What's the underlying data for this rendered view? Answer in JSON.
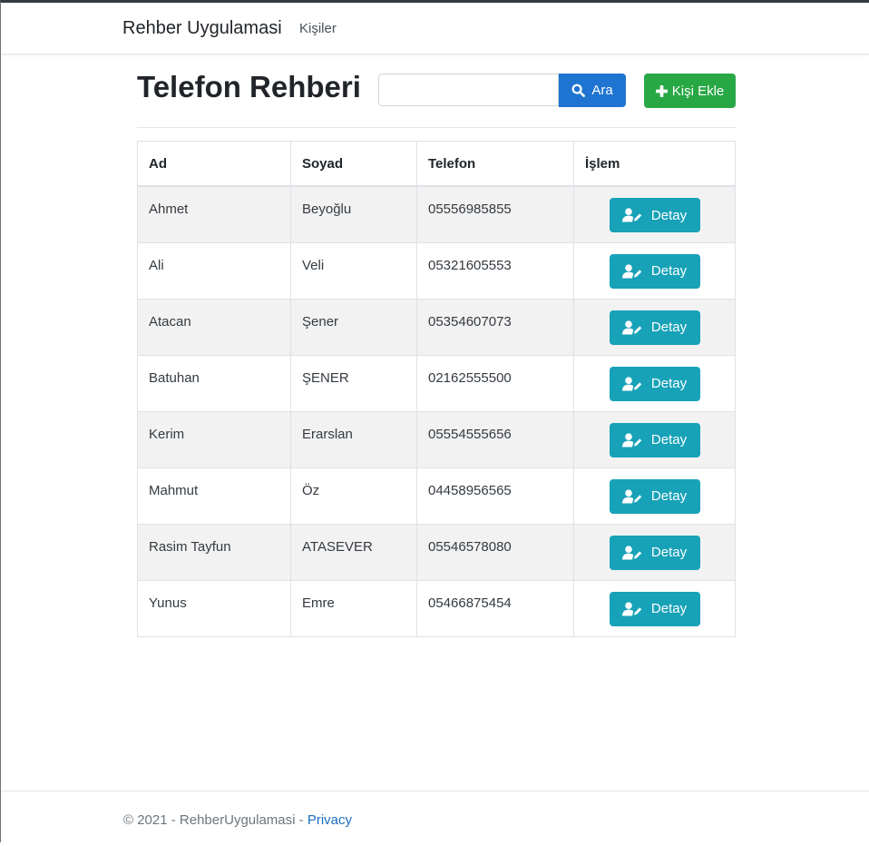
{
  "navbar": {
    "brand": "Rehber Uygulamasi",
    "links": [
      "Kişiler"
    ]
  },
  "header": {
    "title": "Telefon Rehberi",
    "search_placeholder": "",
    "search_value": "",
    "search_button": "Ara",
    "add_button": "Kişi Ekle"
  },
  "table": {
    "columns": [
      "Ad",
      "Soyad",
      "Telefon",
      "İşlem"
    ],
    "rows": [
      {
        "ad": "Ahmet",
        "soyad": "Beyoğlu",
        "telefon": "05556985855",
        "action": "Detay"
      },
      {
        "ad": "Ali",
        "soyad": "Veli",
        "telefon": "05321605553",
        "action": "Detay"
      },
      {
        "ad": "Atacan",
        "soyad": "Şener",
        "telefon": "05354607073",
        "action": "Detay"
      },
      {
        "ad": "Batuhan",
        "soyad": "ŞENER",
        "telefon": "02162555500",
        "action": "Detay"
      },
      {
        "ad": "Kerim",
        "soyad": "Erarslan",
        "telefon": "05554555656",
        "action": "Detay"
      },
      {
        "ad": "Mahmut",
        "soyad": "Öz",
        "telefon": "04458956565",
        "action": "Detay"
      },
      {
        "ad": "Rasim Tayfun",
        "soyad": "ATASEVER",
        "telefon": "05546578080",
        "action": "Detay"
      },
      {
        "ad": "Yunus",
        "soyad": "Emre",
        "telefon": "05466875454",
        "action": "Detay"
      }
    ]
  },
  "footer": {
    "text": "© 2021 - RehberUygulamasi - ",
    "link": "Privacy"
  },
  "icons": {
    "search": "search-icon",
    "add": "plus-icon",
    "detail": "user-edit-icon"
  },
  "colors": {
    "primary": "#1e74d0",
    "success": "#28a745",
    "info": "#17a2b8",
    "link": "#1b6ec2"
  }
}
